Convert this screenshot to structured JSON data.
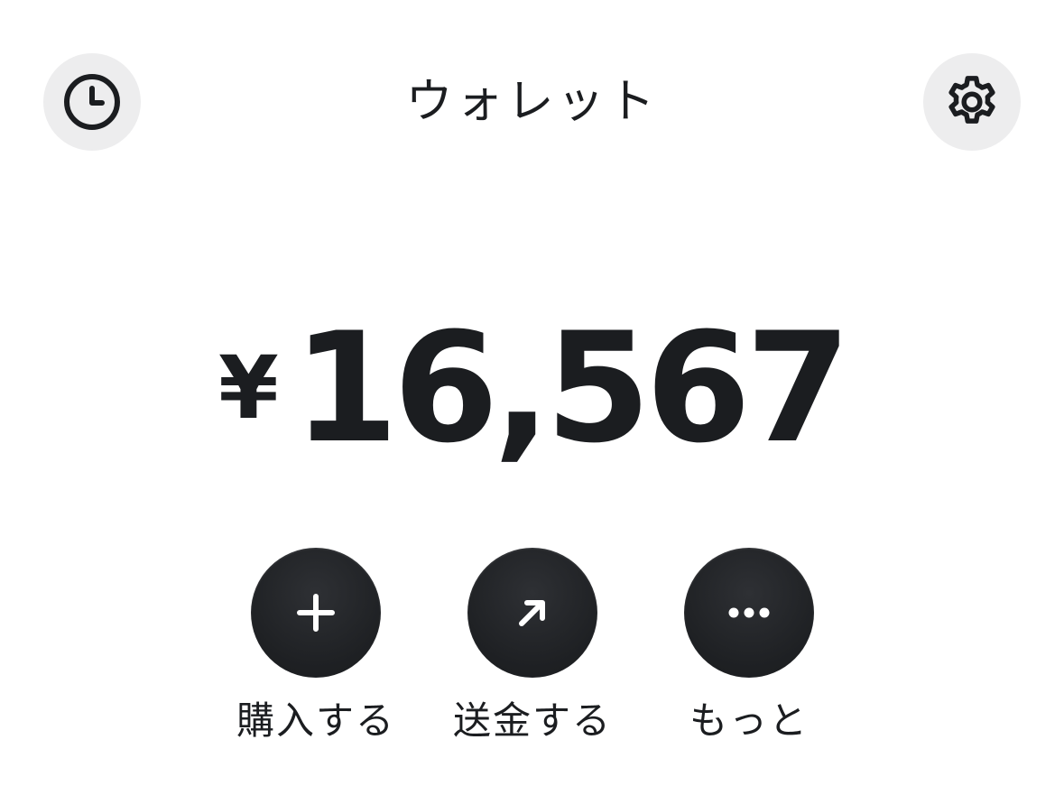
{
  "header": {
    "title": "ウォレット",
    "left_icon": "clock-icon",
    "right_icon": "gear-icon"
  },
  "balance": {
    "currency": "¥",
    "amount": "16,567"
  },
  "actions": [
    {
      "label": "購入する",
      "icon": "plus-icon"
    },
    {
      "label": "送金する",
      "icon": "arrow-up-right-icon"
    },
    {
      "label": "もっと",
      "icon": "more-icon"
    }
  ],
  "colors": {
    "text": "#1b1d20",
    "icon_bg": "#ededee",
    "action_bg": "#1e2023",
    "background": "#ffffff"
  }
}
